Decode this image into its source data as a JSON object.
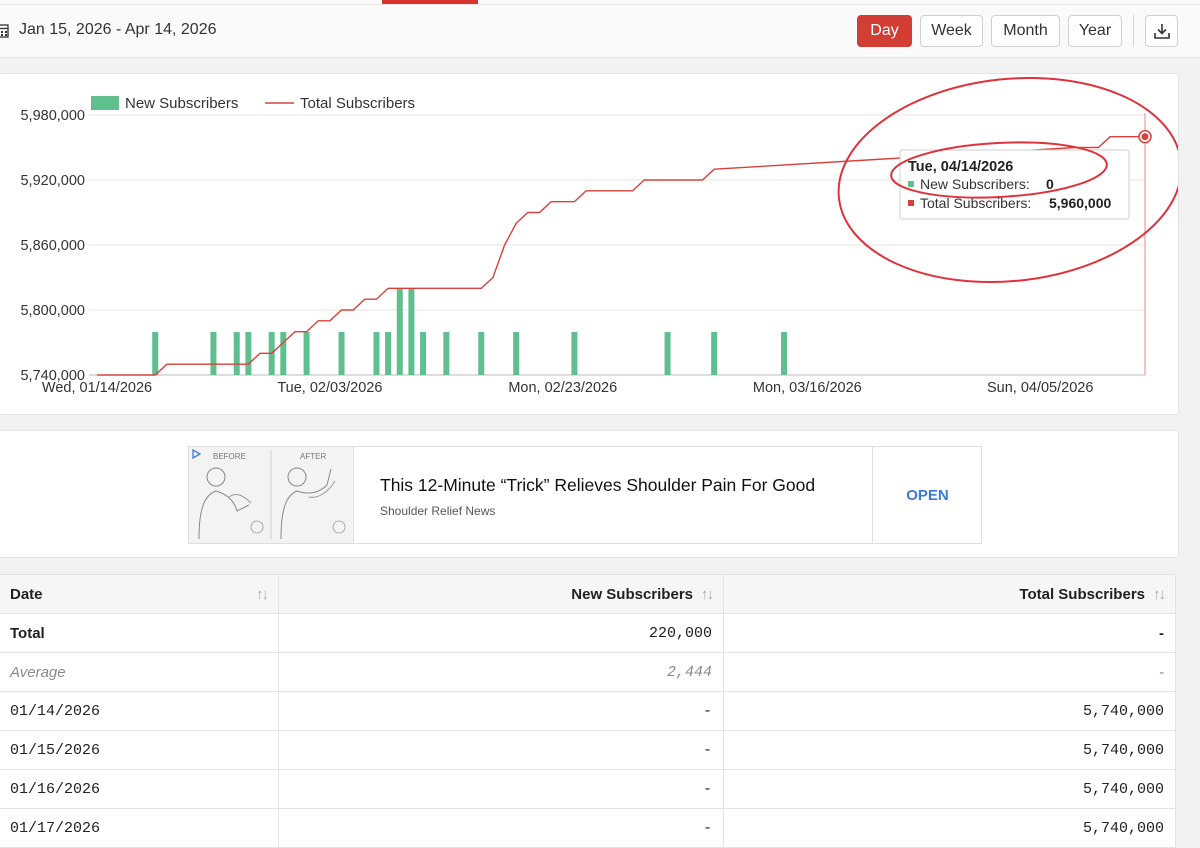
{
  "toolbar": {
    "date_range": "Jan 15, 2026 - Apr 14, 2026",
    "buttons": {
      "day": "Day",
      "week": "Week",
      "month": "Month",
      "year": "Year"
    },
    "active_button": "Day",
    "download_icon": "download-icon",
    "calendar_icon": "calendar-icon"
  },
  "colors": {
    "accent": "#d23d34",
    "bar": "#5fbf8f",
    "line": "#d9403a",
    "link": "#3c7bd5"
  },
  "chart_data": {
    "type": "bar+line",
    "legend": [
      "New Subscribers",
      "Total Subscribers"
    ],
    "ylim": [
      5740000,
      5980000
    ],
    "yticks": [
      "5,980,000",
      "5,920,000",
      "5,860,000",
      "5,800,000",
      "5,740,000"
    ],
    "xticks": [
      "Wed, 01/14/2026",
      "Tue, 02/03/2026",
      "Mon, 02/23/2026",
      "Mon, 03/16/2026",
      "Sun, 04/05/2026"
    ],
    "x_start": "2026-01-14",
    "x_end": "2026-04-14",
    "bars": [
      {
        "date": "01/19/2026",
        "value": 10000
      },
      {
        "date": "01/24/2026",
        "value": 10000
      },
      {
        "date": "01/26/2026",
        "value": 10000
      },
      {
        "date": "01/27/2026",
        "value": 10000
      },
      {
        "date": "01/29/2026",
        "value": 10000
      },
      {
        "date": "01/30/2026",
        "value": 10000
      },
      {
        "date": "02/01/2026",
        "value": 10000
      },
      {
        "date": "02/04/2026",
        "value": 10000
      },
      {
        "date": "02/07/2026",
        "value": 10000
      },
      {
        "date": "02/08/2026",
        "value": 10000
      },
      {
        "date": "02/09/2026",
        "value": 20000
      },
      {
        "date": "02/10/2026",
        "value": 20000
      },
      {
        "date": "02/11/2026",
        "value": 10000
      },
      {
        "date": "02/13/2026",
        "value": 10000
      },
      {
        "date": "02/16/2026",
        "value": 10000
      },
      {
        "date": "02/19/2026",
        "value": 10000
      },
      {
        "date": "02/24/2026",
        "value": 10000
      },
      {
        "date": "03/04/2026",
        "value": 10000
      },
      {
        "date": "03/08/2026",
        "value": 10000
      },
      {
        "date": "03/14/2026",
        "value": 10000
      }
    ],
    "line": [
      {
        "date": "01/14/2026",
        "value": 5740000
      },
      {
        "date": "01/19/2026",
        "value": 5740000
      },
      {
        "date": "01/20/2026",
        "value": 5750000
      },
      {
        "date": "01/27/2026",
        "value": 5750000
      },
      {
        "date": "01/28/2026",
        "value": 5760000
      },
      {
        "date": "01/29/2026",
        "value": 5760000
      },
      {
        "date": "01/30/2026",
        "value": 5770000
      },
      {
        "date": "01/31/2026",
        "value": 5780000
      },
      {
        "date": "02/01/2026",
        "value": 5780000
      },
      {
        "date": "02/02/2026",
        "value": 5790000
      },
      {
        "date": "02/03/2026",
        "value": 5790000
      },
      {
        "date": "02/04/2026",
        "value": 5800000
      },
      {
        "date": "02/05/2026",
        "value": 5800000
      },
      {
        "date": "02/06/2026",
        "value": 5810000
      },
      {
        "date": "02/07/2026",
        "value": 5810000
      },
      {
        "date": "02/08/2026",
        "value": 5820000
      },
      {
        "date": "02/16/2026",
        "value": 5820000
      },
      {
        "date": "02/17/2026",
        "value": 5830000
      },
      {
        "date": "02/18/2026",
        "value": 5860000
      },
      {
        "date": "02/19/2026",
        "value": 5880000
      },
      {
        "date": "02/20/2026",
        "value": 5890000
      },
      {
        "date": "02/21/2026",
        "value": 5890000
      },
      {
        "date": "02/22/2026",
        "value": 5900000
      },
      {
        "date": "02/24/2026",
        "value": 5900000
      },
      {
        "date": "02/25/2026",
        "value": 5910000
      },
      {
        "date": "03/01/2026",
        "value": 5910000
      },
      {
        "date": "03/02/2026",
        "value": 5920000
      },
      {
        "date": "03/07/2026",
        "value": 5920000
      },
      {
        "date": "03/08/2026",
        "value": 5930000
      },
      {
        "date": "04/08/2026",
        "value": 5950000
      },
      {
        "date": "04/10/2026",
        "value": 5950000
      },
      {
        "date": "04/11/2026",
        "value": 5960000
      },
      {
        "date": "04/14/2026",
        "value": 5960000
      }
    ],
    "tooltip": {
      "title": "Tue, 04/14/2026",
      "new_label": "New Subscribers:",
      "new_value": "0",
      "total_label": "Total Subscribers:",
      "total_value": "5,960,000"
    }
  },
  "ad": {
    "before_label": "BEFORE",
    "after_label": "AFTER",
    "title": "This 12-Minute “Trick” Relieves Shoulder Pain For Good",
    "source": "Shoulder Relief News",
    "cta": "OPEN",
    "play_icon": "ad-choices-icon"
  },
  "table": {
    "headers": [
      "Date",
      "New Subscribers",
      "Total Subscribers"
    ],
    "total_row": [
      "Total",
      "220,000",
      "-"
    ],
    "average_row": [
      "Average",
      "2,444",
      "-"
    ],
    "rows": [
      [
        "01/14/2026",
        "-",
        "5,740,000"
      ],
      [
        "01/15/2026",
        "-",
        "5,740,000"
      ],
      [
        "01/16/2026",
        "-",
        "5,740,000"
      ],
      [
        "01/17/2026",
        "-",
        "5,740,000"
      ]
    ]
  }
}
